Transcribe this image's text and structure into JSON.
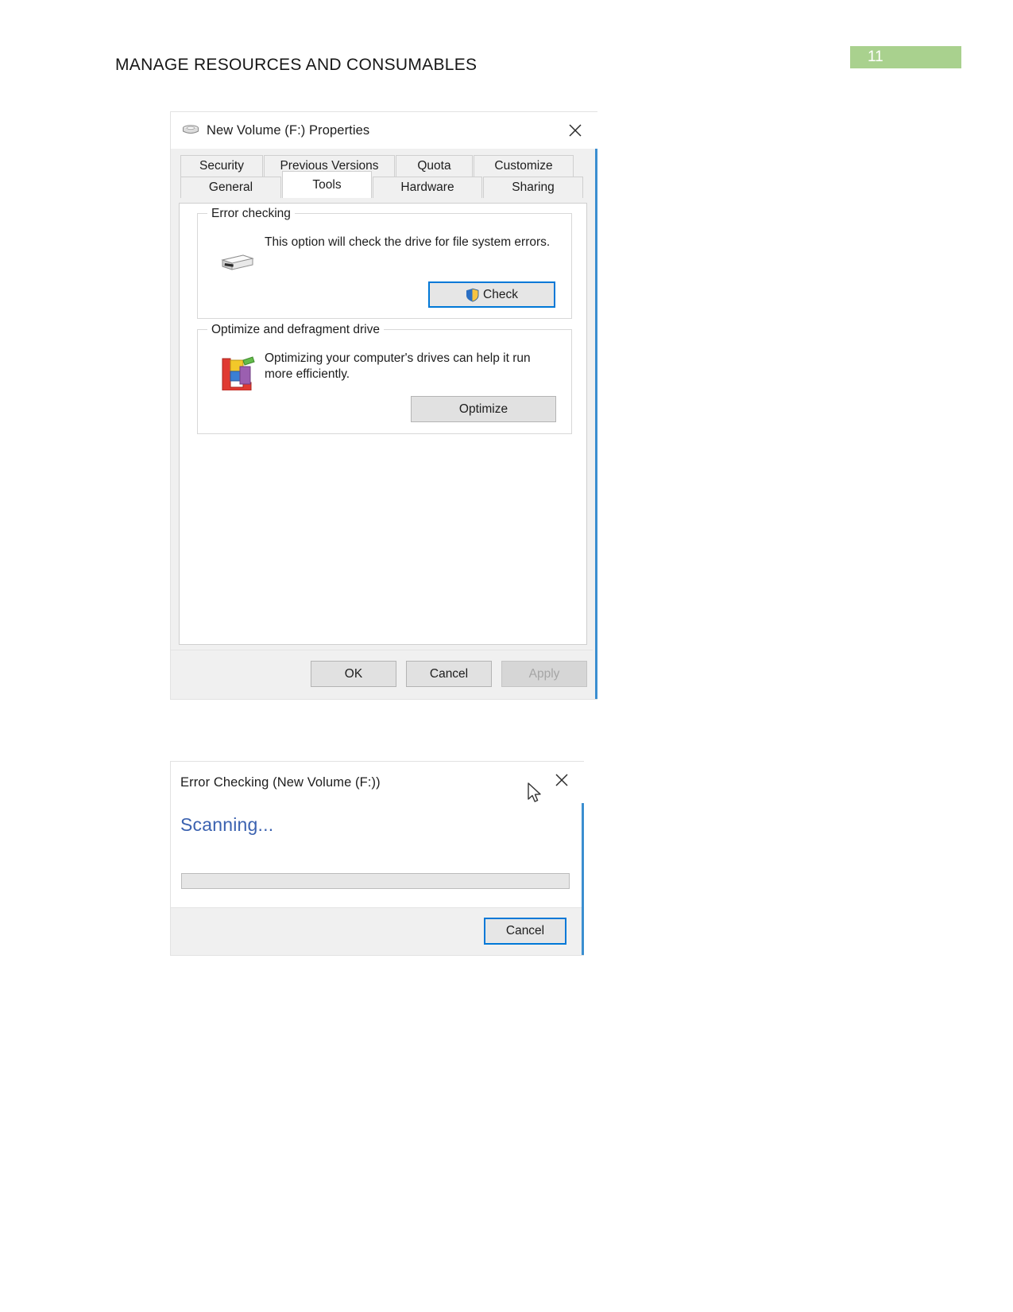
{
  "page": {
    "heading": "MANAGE RESOURCES AND CONSUMABLES",
    "page_number": "11",
    "badge_color": "#a9d18e",
    "accent_color": "#3b8ed0"
  },
  "properties_dialog": {
    "title": "New Volume (F:) Properties",
    "drive_icon": "drive-icon",
    "close_icon": "close-icon",
    "tabs_row1": [
      {
        "label": "Security",
        "selected": false
      },
      {
        "label": "Previous Versions",
        "selected": false
      },
      {
        "label": "Quota",
        "selected": false
      },
      {
        "label": "Customize",
        "selected": false
      }
    ],
    "tabs_row2": [
      {
        "label": "General",
        "selected": false
      },
      {
        "label": "Tools",
        "selected": true
      },
      {
        "label": "Hardware",
        "selected": false
      },
      {
        "label": "Sharing",
        "selected": false
      }
    ],
    "error_checking": {
      "group_title": "Error checking",
      "description": "This option will check the drive for file system errors.",
      "icon": "hard-drive-icon",
      "button_label": "Check",
      "button_icon": "uac-shield-icon",
      "button_focused": true
    },
    "optimize": {
      "group_title": "Optimize and defragment drive",
      "description": "Optimizing your computer's drives can help it run more efficiently.",
      "icon": "defragment-icon",
      "button_label": "Optimize"
    },
    "footer": {
      "ok_label": "OK",
      "cancel_label": "Cancel",
      "apply_label": "Apply",
      "apply_disabled": true
    }
  },
  "error_checking_dialog": {
    "title": "Error Checking (New Volume (F:))",
    "close_icon": "close-icon",
    "status_label": "Scanning...",
    "status_color": "#3b62b0",
    "progress_percent": 0,
    "cancel_label": "Cancel",
    "cancel_focused": true
  }
}
